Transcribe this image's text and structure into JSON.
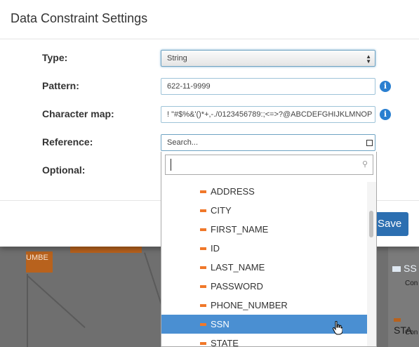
{
  "background": {
    "node_label": "UMBE",
    "panel": {
      "item1": "SS",
      "item1_sub": "Con",
      "item2": "STA",
      "item2_sub": "Con"
    }
  },
  "modal": {
    "title": "Data Constraint Settings",
    "type_label": "Type:",
    "type_value": "String",
    "pattern_label": "Pattern:",
    "pattern_value": "622-11-9999",
    "charmap_label": "Character map:",
    "charmap_value": "! \"#$%&'()*+,-./0123456789:;<=>?@ABCDEFGHIJKLMNOP",
    "reference_label": "Reference:",
    "reference_placeholder": "Search...",
    "optional_label": "Optional:",
    "save_label": "Save",
    "info_glyph": "i"
  },
  "dropdown": {
    "search_value": "",
    "items": [
      "ADDRESS",
      "CITY",
      "FIRST_NAME",
      "ID",
      "LAST_NAME",
      "PASSWORD",
      "PHONE_NUMBER",
      "SSN",
      "STATE"
    ],
    "selected": "SSN"
  },
  "colors": {
    "accent": "#2c6fb1",
    "selected_row": "#4a8fd2",
    "dash": "#f0782a",
    "node": "#b8621d"
  },
  "icons": {
    "info": "info-icon",
    "select_arrows": "select-arrows-icon",
    "search": "search-icon",
    "dash": "table-dash-icon",
    "cursor": "hand-cursor-icon"
  }
}
